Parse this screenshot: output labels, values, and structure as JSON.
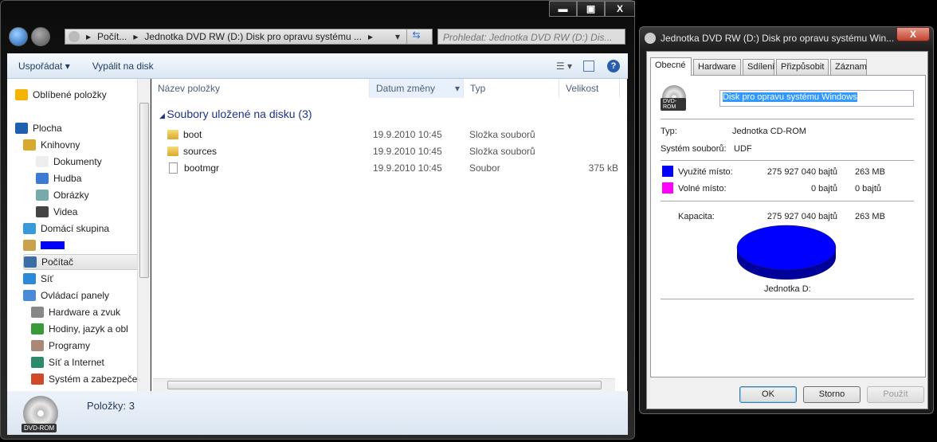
{
  "explorer": {
    "window_buttons": {
      "minimize": "▬",
      "maximize": "▣",
      "close": "X"
    },
    "address": {
      "crumbs": [
        "Počít...",
        "Jednotka DVD RW (D:) Disk pro opravu systému ..."
      ]
    },
    "search_placeholder": "Prohledat: Jednotka DVD RW (D:) Dis...",
    "toolbar": {
      "organize": "Uspořádat ▾",
      "burn": "Vypálit na disk"
    },
    "nav": [
      {
        "label": "Oblíbené položky",
        "icon": "star-icon"
      },
      {
        "label": "Plocha",
        "icon": "desktop-icon"
      },
      {
        "label": "Knihovny",
        "icon": "libraries-icon"
      },
      {
        "label": "Dokumenty",
        "icon": "documents-icon"
      },
      {
        "label": "Hudba",
        "icon": "music-icon"
      },
      {
        "label": "Obrázky",
        "icon": "pictures-icon"
      },
      {
        "label": "Videa",
        "icon": "videos-icon"
      },
      {
        "label": "Domácí skupina",
        "icon": "homegroup-icon"
      },
      {
        "label": "",
        "icon": "user-icon"
      },
      {
        "label": "Počítač",
        "icon": "computer-icon"
      },
      {
        "label": "Síť",
        "icon": "network-icon"
      },
      {
        "label": "Ovládací panely",
        "icon": "control-panel-icon"
      },
      {
        "label": "Hardware a zvuk",
        "icon": "hardware-icon"
      },
      {
        "label": "Hodiny, jazyk a obl",
        "icon": "clock-icon"
      },
      {
        "label": "Programy",
        "icon": "programs-icon"
      },
      {
        "label": "Síť a Internet",
        "icon": "internet-icon"
      },
      {
        "label": "Systém a zabezpeče",
        "icon": "security-icon"
      }
    ],
    "columns": [
      "Název položky",
      "Datum změny",
      "Typ",
      "Velikost"
    ],
    "group": "Soubory uložené na disku (3)",
    "files": [
      {
        "name": "boot",
        "date": "19.9.2010 10:45",
        "type": "Složka souborů",
        "size": ""
      },
      {
        "name": "sources",
        "date": "19.9.2010 10:45",
        "type": "Složka souborů",
        "size": ""
      },
      {
        "name": "bootmgr",
        "date": "19.9.2010 10:45",
        "type": "Soubor",
        "size": "375 kB"
      }
    ],
    "status": {
      "items": "Položky: 3",
      "icon_label": "DVD-ROM"
    }
  },
  "props": {
    "title": "Jednotka DVD RW (D:) Disk pro opravu systému Win...",
    "tabs": [
      "Obecné",
      "Hardware",
      "Sdílení",
      "Přizpůsobit",
      "Záznam"
    ],
    "icon_label": "DVD-ROM",
    "name_value": "Disk pro opravu systému Windows",
    "type_label": "Typ:",
    "type_value": "Jednotka CD-ROM",
    "fs_label": "Systém souborů:",
    "fs_value": "UDF",
    "used_label": "Využité místo:",
    "used_bytes": "275 927 040 bajtů",
    "used_size": "263 MB",
    "free_label": "Volné místo:",
    "free_bytes": "0 bajtů",
    "free_size": "0 bajtů",
    "cap_label": "Kapacita:",
    "cap_bytes": "275 927 040 bajtů",
    "cap_size": "263 MB",
    "drive_label": "Jednotka D:",
    "used_fraction": 1.0,
    "colors": {
      "used": "#0000ff",
      "free": "#ff00ff"
    },
    "buttons": {
      "ok": "OK",
      "cancel": "Storno",
      "apply": "Použít"
    }
  }
}
